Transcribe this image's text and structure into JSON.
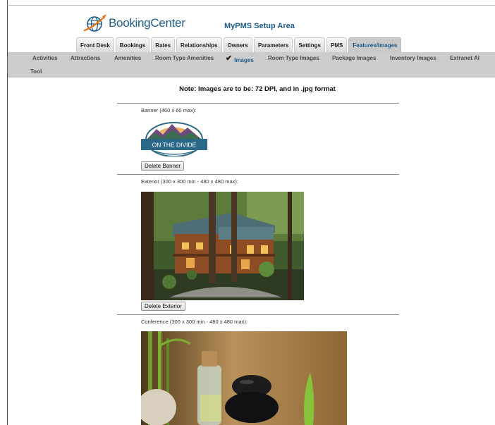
{
  "app": {
    "logo_text": "BookingCenter",
    "section_title": "MyPMS Setup Area"
  },
  "main_tabs": [
    {
      "label": "Front Desk"
    },
    {
      "label": "Bookings"
    },
    {
      "label": "Rates"
    },
    {
      "label": "Relationships"
    },
    {
      "label": "Owners"
    },
    {
      "label": "Parameters"
    },
    {
      "label": "Settings"
    },
    {
      "label": "PMS"
    },
    {
      "label": "Features/Images",
      "active": true
    }
  ],
  "sub_nav": [
    {
      "label": "Activities"
    },
    {
      "label": "Attractions"
    },
    {
      "label": "Amenities"
    },
    {
      "label": "Room Type Amenities"
    },
    {
      "label": "Images",
      "active": true
    },
    {
      "label": "Room Type Images"
    },
    {
      "label": "Package Images"
    },
    {
      "label": "Inventory Images"
    },
    {
      "label": "Extranet AI"
    },
    {
      "label": "Tool"
    }
  ],
  "note": "Note: Images are to be: 72 DPI, and in .jpg format",
  "sections": {
    "banner": {
      "label": "Banner (460 x 60 max):",
      "image_text": "ON THE DIVIDE",
      "delete_label": "Delete Banner"
    },
    "exterior": {
      "label": "Exterior (300 x 300 min - 480 x 480 max):",
      "delete_label": "Delete Exterior"
    },
    "conference": {
      "label": "Conference (300 x 300 min - 480 x 480 max):"
    }
  },
  "colors": {
    "brand_blue": "#1d5c8c",
    "subnav_bg": "#cccccc",
    "active_tab_bg": "#c9c9c9"
  },
  "icons": {
    "logo": "globe-airplane-icon",
    "active_marker": "checkmark-icon"
  }
}
